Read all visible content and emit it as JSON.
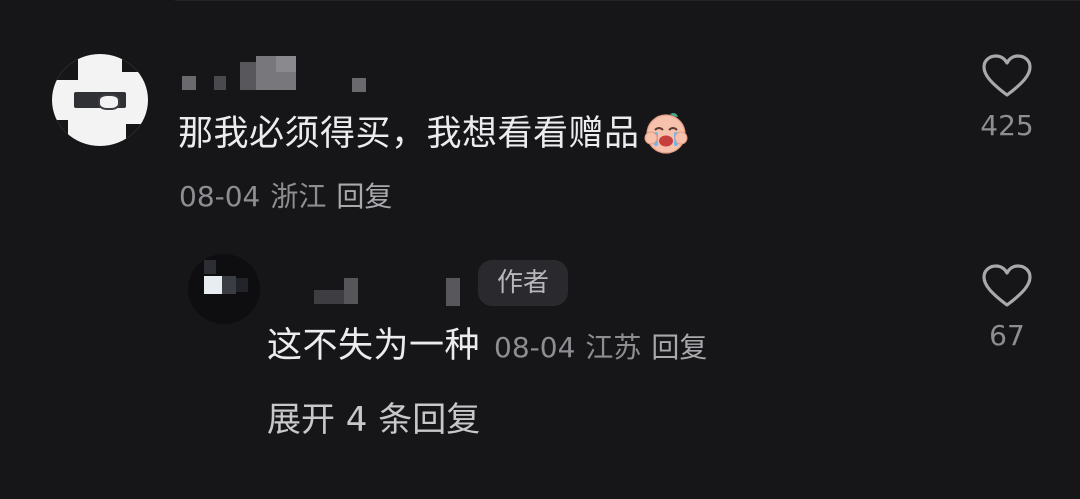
{
  "comment": {
    "text": "那我必须得买，我想看看赠品",
    "emoji_icon": "crying-baby-emoji-icon",
    "date": "08-04",
    "location": "浙江",
    "reply_label": "回复",
    "like_count": "425",
    "like_icon": "heart-outline-icon"
  },
  "reply": {
    "author_badge": "作者",
    "text": "这不失为一种",
    "date": "08-04",
    "location": "江苏",
    "reply_label": "回复",
    "like_count": "67",
    "like_icon": "heart-outline-icon"
  },
  "expand": {
    "label": "展开 4 条回复"
  },
  "colors": {
    "background": "#161618",
    "primary_text": "#ececee",
    "secondary_text": "#8d8d92",
    "badge_bg": "#2a2a2e"
  }
}
